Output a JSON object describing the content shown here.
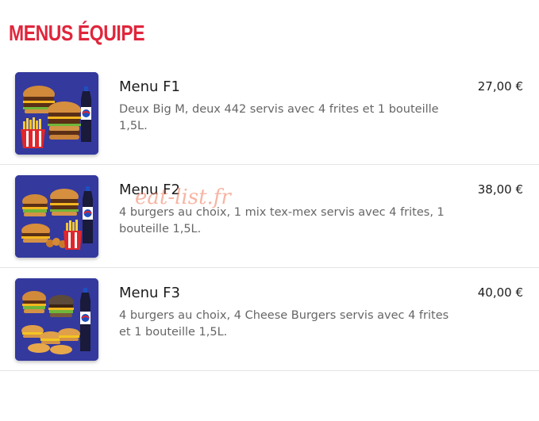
{
  "section": {
    "title": "MENUS ÉQUIPE"
  },
  "watermark": "eat-list.fr",
  "colors": {
    "accent": "#e0263c",
    "thumb_bg": "#34399e"
  },
  "menus": [
    {
      "name": "Menu F1",
      "description": "Deux Big M, deux 442 servis avec 4 frites et 1 bouteille 1,5L.",
      "price": "27,00 €"
    },
    {
      "name": "Menu F2",
      "description": "4 burgers au choix, 1 mix tex-mex servis avec 4 frites, 1 bouteille 1,5L.",
      "price": "38,00 €"
    },
    {
      "name": "Menu F3",
      "description": "4 burgers au choix, 4 Cheese Burgers servis avec 4 frites et 1 bouteille 1,5L.",
      "price": "40,00 €"
    }
  ]
}
